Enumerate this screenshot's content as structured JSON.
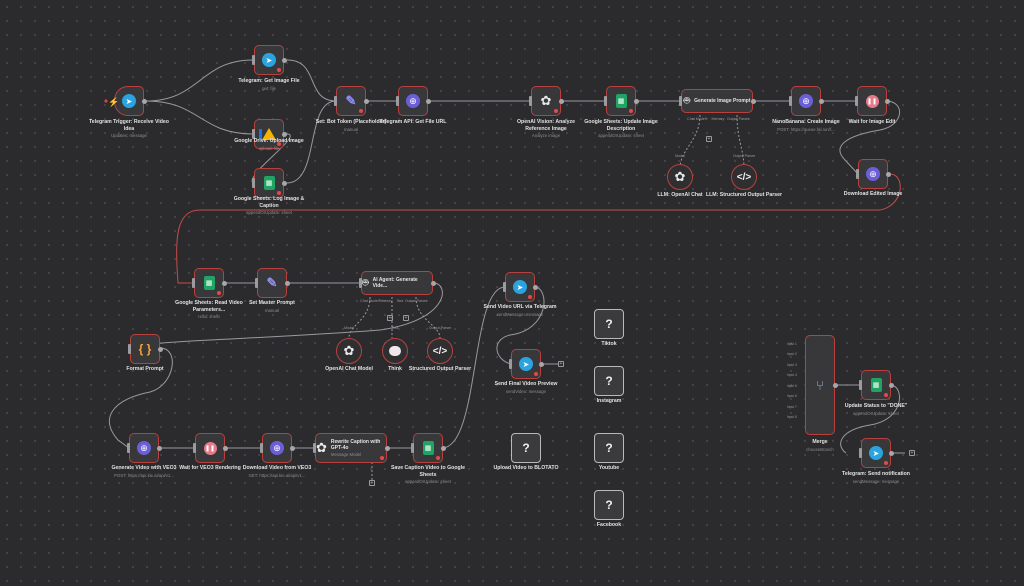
{
  "nodes": {
    "telegram_trigger": {
      "title": "Telegram Trigger: Receive Video Idea",
      "sub": "Updates: message"
    },
    "tg_get_image": {
      "title": "Telegram: Get Image File",
      "sub": "get: file"
    },
    "drive_upload": {
      "title": "Google Drive: Upload Image",
      "sub": "upload: file"
    },
    "sheets_log": {
      "title": "Google Sheets: Log Image & Caption",
      "sub": "appendOrUpdate: sheet"
    },
    "set_bot_token": {
      "title": "Set: Bot Token (Placeholder)",
      "sub": "manual"
    },
    "tg_get_file_url": {
      "title": "Telegram API: Get File URL",
      "sub": ""
    },
    "openai_vision": {
      "title": "OpenAI Vision: Analyze Reference Image",
      "sub": "Analyze image"
    },
    "sheets_update_desc": {
      "title": "Google Sheets: Update Image Description",
      "sub": "appendOrUpdate: sheet"
    },
    "gen_image_prompt": {
      "title": "Generate Image Prompt",
      "sub": ""
    },
    "llm_openai_chat": {
      "title": "LLM: OpenAI Chat",
      "sub": ""
    },
    "llm_structured": {
      "title": "LLM: Structured Output Parser",
      "sub": ""
    },
    "nanobanana": {
      "title": "NanoBanana: Create Image",
      "sub": "POST: https://queue.fal.run/f..."
    },
    "wait_image_edit": {
      "title": "Wait for Image Edit",
      "sub": ""
    },
    "download_edited": {
      "title": "Download Edited Image",
      "sub": ""
    },
    "sheets_read_params": {
      "title": "Google Sheets: Read Video Parameters...",
      "sub": "read: sheet"
    },
    "set_master_prompt": {
      "title": "Set Master Prompt",
      "sub": "manual"
    },
    "ai_agent": {
      "title": "AI Agent: Generate Vide...",
      "sub": ""
    },
    "openai_chat_model": {
      "title": "OpenAI Chat Model",
      "sub": ""
    },
    "think": {
      "title": "Think",
      "sub": ""
    },
    "structured_parser": {
      "title": "Structured Output Parser",
      "sub": ""
    },
    "format_prompt": {
      "title": "Format Prompt",
      "sub": ""
    },
    "generate_video": {
      "title": "Generate Video with VEO3",
      "sub": "POST: https://api.kie.ai/api/v1..."
    },
    "wait_veo3": {
      "title": "Wait for VEO3 Rendering",
      "sub": ""
    },
    "download_video": {
      "title": "Download Video from VEO3",
      "sub": "GET: https://api.kie.ai/api/v1..."
    },
    "rewrite_caption": {
      "title": "Rewrite Caption with GPT-4o",
      "sub": "Message Model"
    },
    "save_caption": {
      "title": "Save Caption Video to Google Sheets",
      "sub": "appendOrUpdate: sheet"
    },
    "send_video_url": {
      "title": "Send Video URL via Telegram",
      "sub": "sendMessage: message"
    },
    "send_final_preview": {
      "title": "Send Final Video Preview",
      "sub": "sendVideo: message"
    },
    "upload_blotato": {
      "title": "Upload Video to BLOTATO",
      "sub": ""
    },
    "tiktok": {
      "title": "Tiktok",
      "sub": ""
    },
    "instagram": {
      "title": "Instagram",
      "sub": ""
    },
    "youtube": {
      "title": "Youtube",
      "sub": ""
    },
    "facebook": {
      "title": "Facebook",
      "sub": ""
    },
    "merge": {
      "title": "Merge",
      "sub": "chooseBranch"
    },
    "update_status": {
      "title": "Update Status to \"DONE\"",
      "sub": "appendOrUpdate: sheet"
    },
    "tg_send_notification": {
      "title": "Telegram: Send notification",
      "sub": "sendMessage: message"
    }
  },
  "ports": {
    "gen_image_prompt": [
      "Chat Model*",
      "Memory",
      "Output Parser"
    ],
    "ai_agent": [
      "Chat Model*",
      "Memory",
      "Tool",
      "Output Parser"
    ],
    "model": "Model",
    "tool": "Tool",
    "output_parser": "Output Parser"
  },
  "merge_inputs": [
    "Input 1",
    "Input 2",
    "Input 3",
    "Input 4",
    "Input 5",
    "Input 6",
    "Input 7",
    "Input 8"
  ],
  "icons": {
    "telegram": "telegram-icon",
    "globe": "globe-icon",
    "sheets": "google-sheets-icon",
    "pen": "pen-icon",
    "pause": "pause-icon",
    "openai": "openai-icon",
    "robot": "robot-icon",
    "code": "code-icon",
    "brain": "brain-icon",
    "braces": "braces-icon",
    "question": "question-icon",
    "merge": "merge-icon",
    "drive": "google-drive-icon"
  },
  "colors": {
    "node_border": "#b8413e",
    "wire": "#9a9a9e",
    "error_wire": "#c94b48",
    "canvas": "#2b2b2d"
  }
}
